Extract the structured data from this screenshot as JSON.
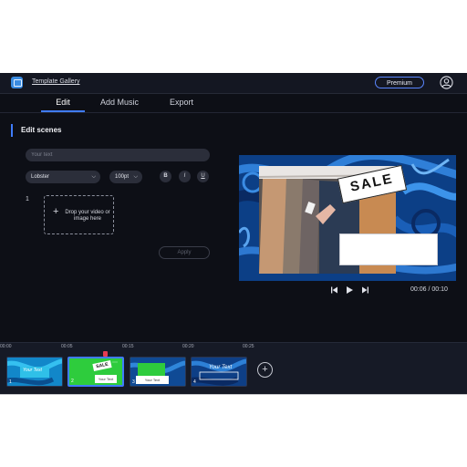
{
  "header": {
    "nav_link": "Template Gallery",
    "premium_label": "Premium",
    "logo_icon": "app-logo-icon",
    "avatar_icon": "user-avatar-icon"
  },
  "tabs": [
    {
      "label": "Edit",
      "active": true
    },
    {
      "label": "Add Music",
      "active": false
    },
    {
      "label": "Export",
      "active": false
    }
  ],
  "editor": {
    "section_title": "Edit scenes",
    "text_placeholder": "Your text",
    "font_value": "Lobster",
    "size_value": "100pt",
    "format_buttons": [
      "B",
      "I",
      "U"
    ],
    "scene_number": "1",
    "drop_text": "Drop your video or image here",
    "apply_label": "Apply"
  },
  "preview": {
    "sale_text": "SALE",
    "timecode": "00:06 / 00:10"
  },
  "timeline": {
    "ticks": [
      "00:00",
      "00:05",
      "00:15",
      "00:20",
      "00:25"
    ],
    "scenes": [
      {
        "number": "1",
        "label": "Your Text",
        "selected": false
      },
      {
        "number": "2",
        "label": "Your Text",
        "badge": "SALE",
        "selected": true
      },
      {
        "number": "3",
        "label": "Your Text",
        "selected": false
      },
      {
        "number": "4",
        "label": "Your Text",
        "selected": false
      }
    ]
  },
  "colors": {
    "accent": "#3f7cff",
    "background": "#0d0f16",
    "swirl": "#0d4d96"
  }
}
